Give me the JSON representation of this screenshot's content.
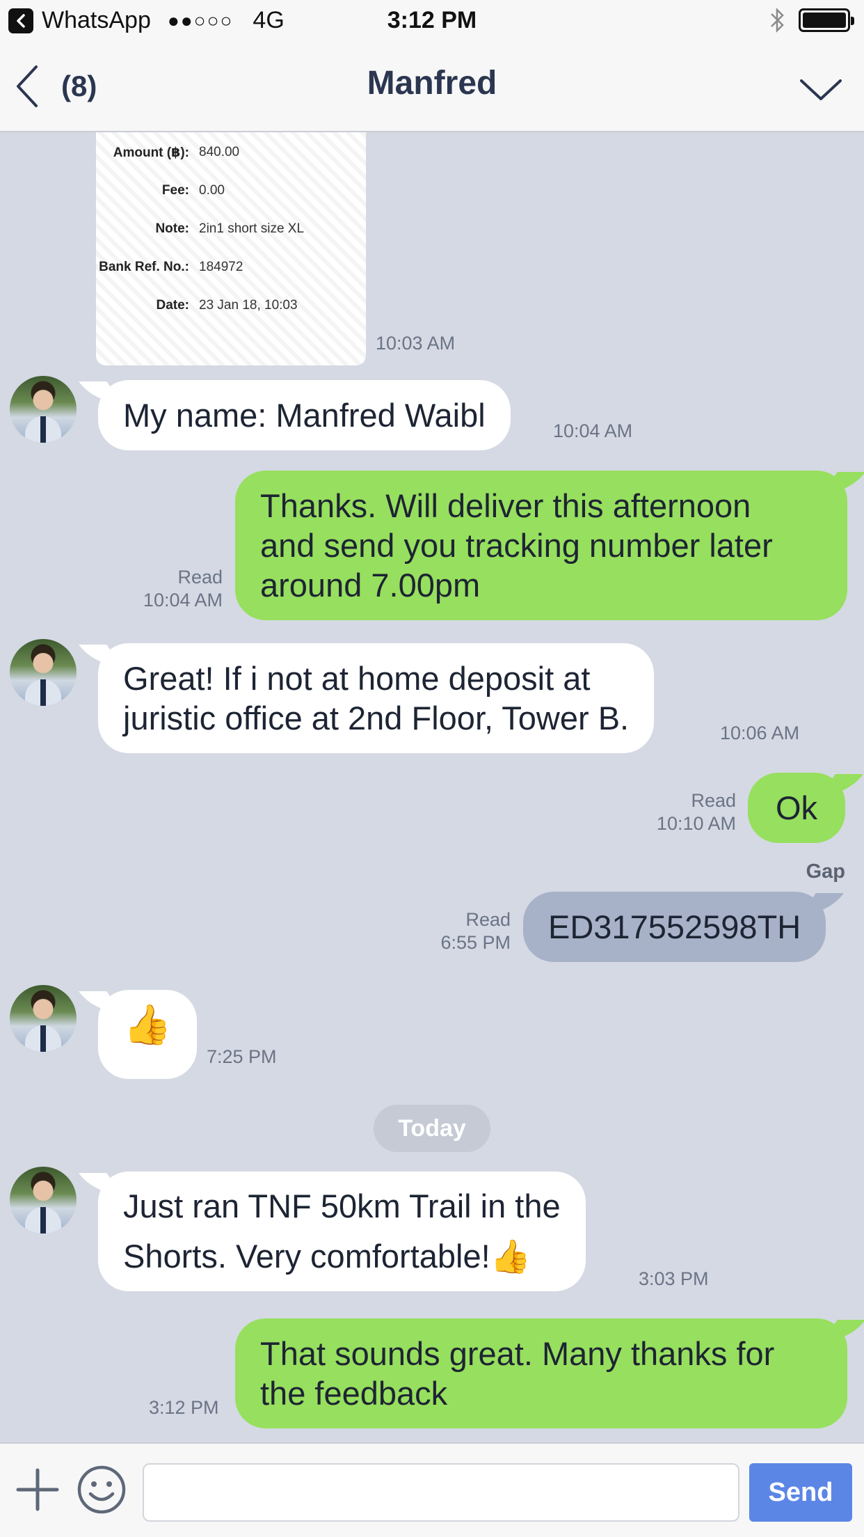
{
  "status_bar": {
    "app": "WhatsApp",
    "signal": "●●○○○",
    "network": "4G",
    "time": "3:12 PM"
  },
  "nav": {
    "back_count": "(8)",
    "title": "Manfred"
  },
  "receipt": {
    "rows": [
      {
        "label": "Amount (฿):",
        "value": "840.00"
      },
      {
        "label": "Fee:",
        "value": "0.00"
      },
      {
        "label": "Note:",
        "value": "2in1 short size XL"
      },
      {
        "label": "Bank Ref. No.:",
        "value": "184972"
      },
      {
        "label": "Date:",
        "value": "23 Jan 18, 10:03"
      }
    ],
    "time": "10:03 AM"
  },
  "messages": [
    {
      "dir": "in",
      "lines": [
        "My name: Manfred Waibl"
      ],
      "time": "10:04 AM"
    },
    {
      "dir": "out",
      "lines": [
        "Thanks. Will deliver this afternoon",
        "and send you tracking number later",
        "around 7.00pm"
      ],
      "status": "Read",
      "time": "10:04 AM"
    },
    {
      "dir": "in",
      "lines": [
        "Great! If i not at home deposit at",
        "juristic office at 2nd Floor, Tower B."
      ],
      "time": "10:06 AM"
    },
    {
      "dir": "out",
      "lines": [
        "Ok"
      ],
      "status": "Read",
      "time": "10:10 AM"
    },
    {
      "dir": "out",
      "sender": "Gap",
      "lines": [
        "ED317552598TH"
      ],
      "status": "Read",
      "time": "6:55 PM"
    },
    {
      "dir": "in",
      "emoji": "👍",
      "time": "7:25 PM"
    },
    {
      "dir": "in",
      "lines": [
        "Just ran TNF 50km Trail in the",
        "Shorts. Very comfortable!👍"
      ],
      "time": "3:03 PM"
    },
    {
      "dir": "out",
      "lines": [
        "That sounds great. Many thanks for",
        "the feedback"
      ],
      "time": "3:12 PM"
    }
  ],
  "day_divider": "Today",
  "input": {
    "placeholder": "",
    "send_label": "Send"
  },
  "colors": {
    "background": "#d4d9e3",
    "incoming": "#ffffff",
    "outgoing": "#97df5e",
    "outgoing_other": "#a7b2c8",
    "send_button": "#5b86e5"
  }
}
